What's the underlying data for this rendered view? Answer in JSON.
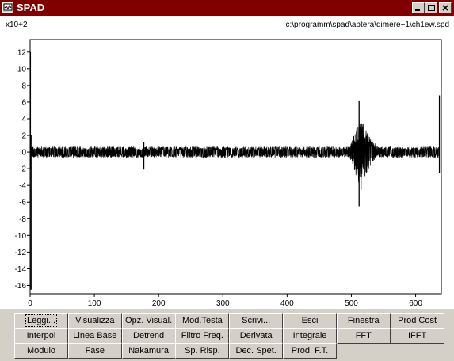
{
  "window": {
    "title": "SPAD",
    "icon": "app-window-icon"
  },
  "title_buttons": [
    {
      "name": "minimize-button",
      "icon": "minimize-icon"
    },
    {
      "name": "maximize-button",
      "icon": "maximize-icon"
    },
    {
      "name": "close-button",
      "icon": "close-icon"
    }
  ],
  "plot": {
    "scale_label": "x10+2",
    "file_path": "c:\\programm\\spad\\aptera\\dimere~1\\ch1ew.spd"
  },
  "chart_data": {
    "type": "line",
    "title": "",
    "xlabel": "",
    "ylabel": "",
    "xlim": [
      0,
      640
    ],
    "ylim": [
      -17,
      13.5
    ],
    "x_ticks": [
      0,
      100,
      200,
      300,
      400,
      500,
      600
    ],
    "y_ticks": [
      12,
      10,
      8,
      6,
      4,
      2,
      0,
      -2,
      -4,
      -6,
      -8,
      -10,
      -12,
      -14,
      -16
    ],
    "series": [
      {
        "color": "#000000",
        "background_noise_amplitude": 0.5,
        "features": [
          {
            "x": 0.5,
            "y_min": -2,
            "y_max": 12
          },
          {
            "x": 1.5,
            "y_min": -16.5,
            "y_max": 2
          },
          {
            "x": 177,
            "y_min": -2.1,
            "y_max": 1.2
          },
          {
            "x": 512,
            "y_min": -6.5,
            "y_max": 6.2
          },
          {
            "x": 515,
            "y_min": -4.5,
            "y_max": 3.5
          },
          {
            "x": 637,
            "y_min": -2.5,
            "y_max": 6.8
          }
        ],
        "event_window": [
          497,
          540
        ]
      }
    ]
  },
  "buttons": [
    [
      "Leggi...",
      "Visualizza",
      "Opz. Visual.",
      "Mod.Testa",
      "Scrivi...",
      "Esci",
      "Finestra",
      "Prod Cost"
    ],
    [
      "Interpol",
      "Linea Base",
      "Detrend",
      "Filtro Freq.",
      "Derivata",
      "Integrale",
      "FFT",
      "IFFT"
    ],
    [
      "Modulo",
      "Fase",
      "Nakamura",
      "Sp. Risp.",
      "Dec. Spet.",
      "Prod. F.T."
    ]
  ]
}
